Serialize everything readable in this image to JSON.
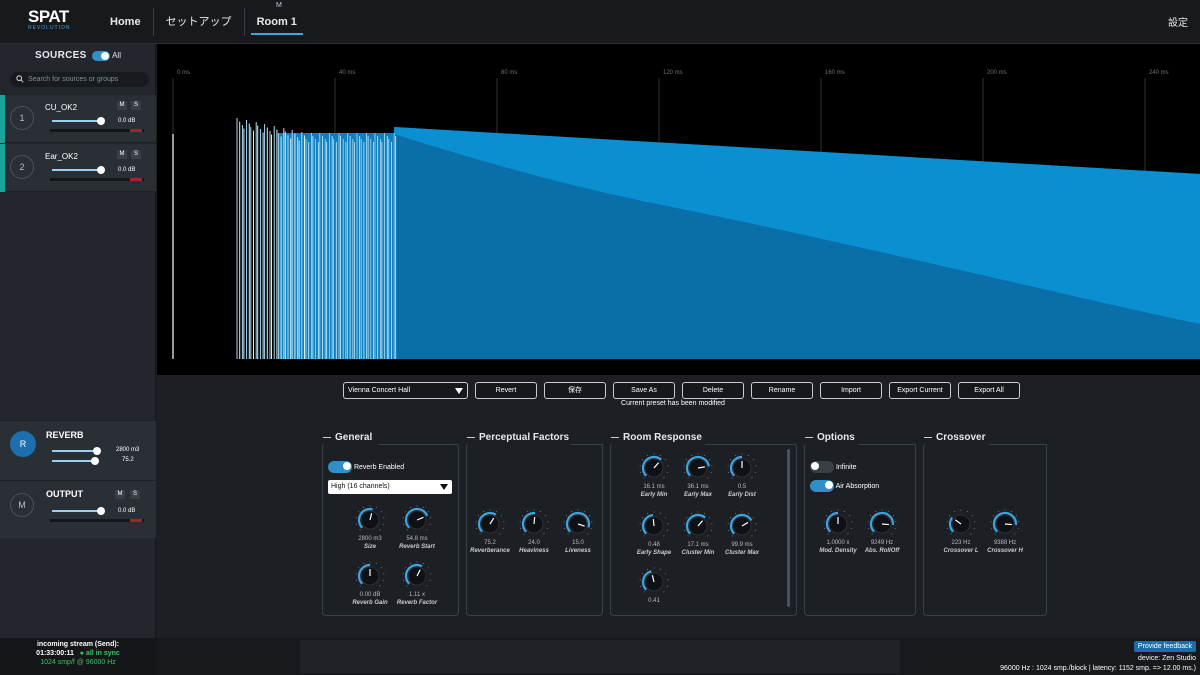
{
  "app": {
    "logo_main": "SPAT",
    "logo_sub": "REVOLUTION",
    "nav": [
      "Home",
      "セットアップ",
      "Room 1"
    ],
    "room_badge": "M",
    "settings": "設定"
  },
  "sidebar": {
    "sources_title": "SOURCES",
    "all_label": "All",
    "search_placeholder": "Search for sources or groups",
    "sources": [
      {
        "num": "1",
        "name": "CU_OK2",
        "mute": "M",
        "solo": "S",
        "level": "0.0 dB",
        "fader": 0.8
      },
      {
        "num": "2",
        "name": "Ear_OK2",
        "mute": "M",
        "solo": "S",
        "level": "0.0 dB",
        "fader": 0.8
      }
    ],
    "reverb": {
      "badge": "R",
      "title": "REVERB",
      "size": "2800 m3",
      "value2": "75.2"
    },
    "output": {
      "badge": "M",
      "title": "OUTPUT",
      "mute": "M",
      "solo": "S",
      "level": "0.0 dB",
      "fader": 0.8
    }
  },
  "graph": {
    "ticks": [
      "0 ms",
      "40 ms",
      "80 ms",
      "120 ms",
      "160 ms",
      "200 ms",
      "240 ms"
    ],
    "colors": {
      "bg": "#000000",
      "early": "#a8dcf5",
      "tail_light": "#0a8fd0",
      "tail_dark": "#0a6ea8"
    }
  },
  "presets": {
    "current": "Vienna Concert Hall",
    "buttons": [
      "Revert",
      "保存",
      "Save As",
      "Delete",
      "Rename",
      "Import",
      "Export Current",
      "Export All"
    ],
    "status": "Current preset has been modified"
  },
  "sections": {
    "general": {
      "title": "General",
      "reverb_enabled": "Reverb Enabled",
      "quality": "High (16 channels)",
      "knobs": [
        {
          "value": "2800 m3",
          "label": "Size",
          "level": 0.55
        },
        {
          "value": "54.8 ms",
          "label": "Reverb Start",
          "level": 0.75
        },
        {
          "value": "0.00 dB",
          "label": "Reverb Gain",
          "level": 0.5
        },
        {
          "value": "1.11 x",
          "label": "Reverb Factor",
          "level": 0.6
        }
      ]
    },
    "perceptual": {
      "title": "Perceptual Factors",
      "knobs": [
        {
          "value": "75.2",
          "label": "Reverberance",
          "level": 0.62
        },
        {
          "value": "24.0",
          "label": "Heaviness",
          "level": 0.52
        },
        {
          "value": "15.0",
          "label": "Liveness",
          "level": 0.9
        }
      ]
    },
    "room": {
      "title": "Room Response",
      "knobs": [
        {
          "value": "16.1 ms",
          "label": "Early Min",
          "level": 0.65
        },
        {
          "value": "36.1 ms",
          "label": "Early Max",
          "level": 0.8
        },
        {
          "value": "0.5",
          "label": "Early Dist",
          "level": 0.5
        },
        {
          "value": "0.48",
          "label": "Early Shape",
          "level": 0.48
        },
        {
          "value": "17.1 ms",
          "label": "Cluster Min",
          "level": 0.65
        },
        {
          "value": "99.9 ms",
          "label": "Cluster Max",
          "level": 0.72
        },
        {
          "value": "0.41",
          "label": "",
          "level": 0.45
        }
      ]
    },
    "options": {
      "title": "Options",
      "infinite": "Infinite",
      "air_absorption": "Air Absorption",
      "knobs": [
        {
          "value": "1.0000 x",
          "label": "Mod. Density",
          "level": 0.5
        },
        {
          "value": "9249 Hz",
          "label": "Abs. RollOff",
          "level": 0.85
        }
      ]
    },
    "crossover": {
      "title": "Crossover",
      "knobs": [
        {
          "value": "223 Hz",
          "label": "Crossover L",
          "level": 0.3
        },
        {
          "value": "9388 Hz",
          "label": "Crossover H",
          "level": 0.85
        }
      ]
    }
  },
  "status": {
    "stream_title": "incoming stream (Send):",
    "time": "01:33:00:11",
    "sync": "all in sync",
    "rate": "1024 smp/f @ 96000 Hz",
    "feedback": "Provide feedback",
    "device": "device: Zen Studio",
    "latency": "96000 Hz : 1024 smp./block | latency: 1152 smp. => 12.00 ms.)"
  },
  "colors": {
    "accent": "#3da6e2",
    "source_accent": "#1ca39a",
    "knob_arc": "#3da6e2"
  }
}
